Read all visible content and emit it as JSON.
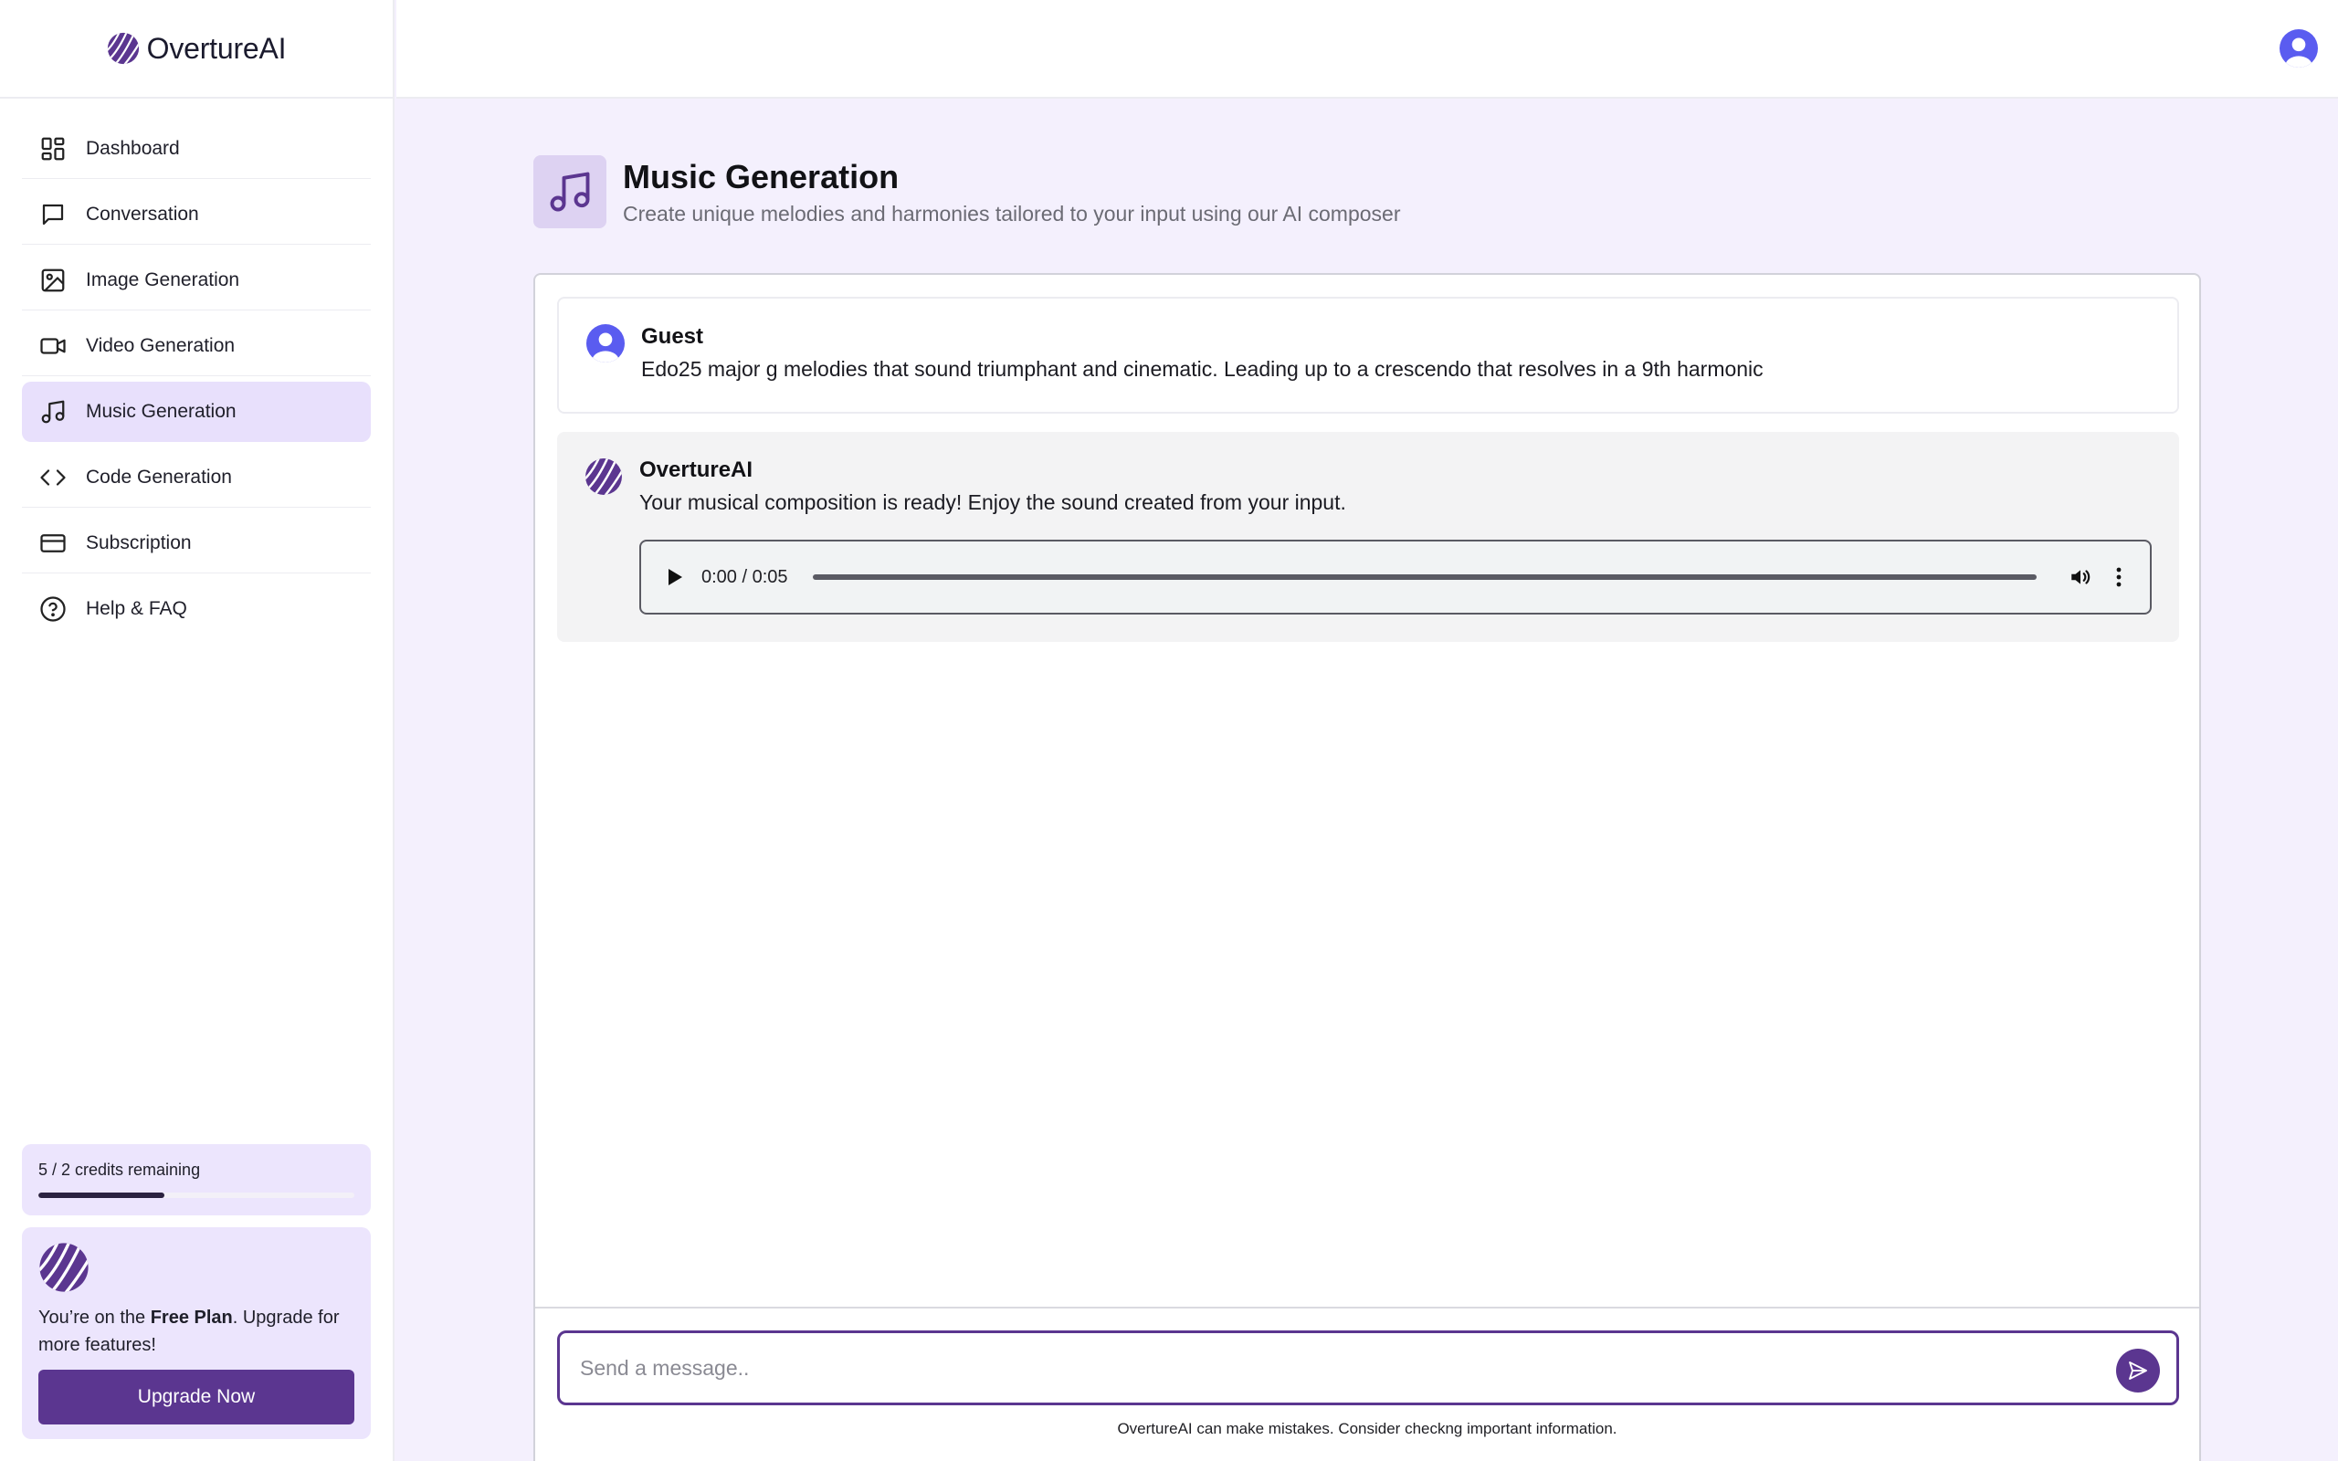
{
  "app": {
    "name": "OvertureAI",
    "accent_color": "#5b3690",
    "highlight_color": "#e8e0fc"
  },
  "sidebar": {
    "items": [
      {
        "label": "Dashboard",
        "icon": "dashboard-icon",
        "active": false
      },
      {
        "label": "Conversation",
        "icon": "chat-bubble-icon",
        "active": false
      },
      {
        "label": "Image Generation",
        "icon": "image-icon",
        "active": false
      },
      {
        "label": "Video Generation",
        "icon": "video-camera-icon",
        "active": false
      },
      {
        "label": "Music Generation",
        "icon": "music-note-icon",
        "active": true
      },
      {
        "label": "Code Generation",
        "icon": "code-icon",
        "active": false
      },
      {
        "label": "Subscription",
        "icon": "credit-card-icon",
        "active": false
      },
      {
        "label": "Help & FAQ",
        "icon": "help-circle-icon",
        "active": false
      }
    ],
    "credits": {
      "text": "5 / 2 credits remaining",
      "progress_fraction": 0.4
    },
    "plan": {
      "prefix": "You’re on the ",
      "plan_name": "Free Plan",
      "suffix": ". Upgrade for more features!",
      "button_label": "Upgrade Now"
    }
  },
  "header": {
    "avatar_icon": "user-avatar-icon"
  },
  "page": {
    "icon": "music-note-icon",
    "title": "Music Generation",
    "subtitle": "Create unique melodies and harmonies tailored to your input using our AI composer"
  },
  "chat": {
    "messages": [
      {
        "role": "user",
        "name": "Guest",
        "text": "Edo25 major g melodies that sound triumphant and cinematic. Leading up to a crescendo that resolves in a 9th harmonic"
      },
      {
        "role": "assistant",
        "name": "OvertureAI",
        "text": "Your musical composition is ready! Enjoy the sound created from your input.",
        "audio": {
          "time": "0:00 / 0:05"
        }
      }
    ],
    "composer": {
      "placeholder": "Send a message..",
      "value": ""
    },
    "disclaimer": "OvertureAI can make mistakes. Consider checkng important information."
  }
}
